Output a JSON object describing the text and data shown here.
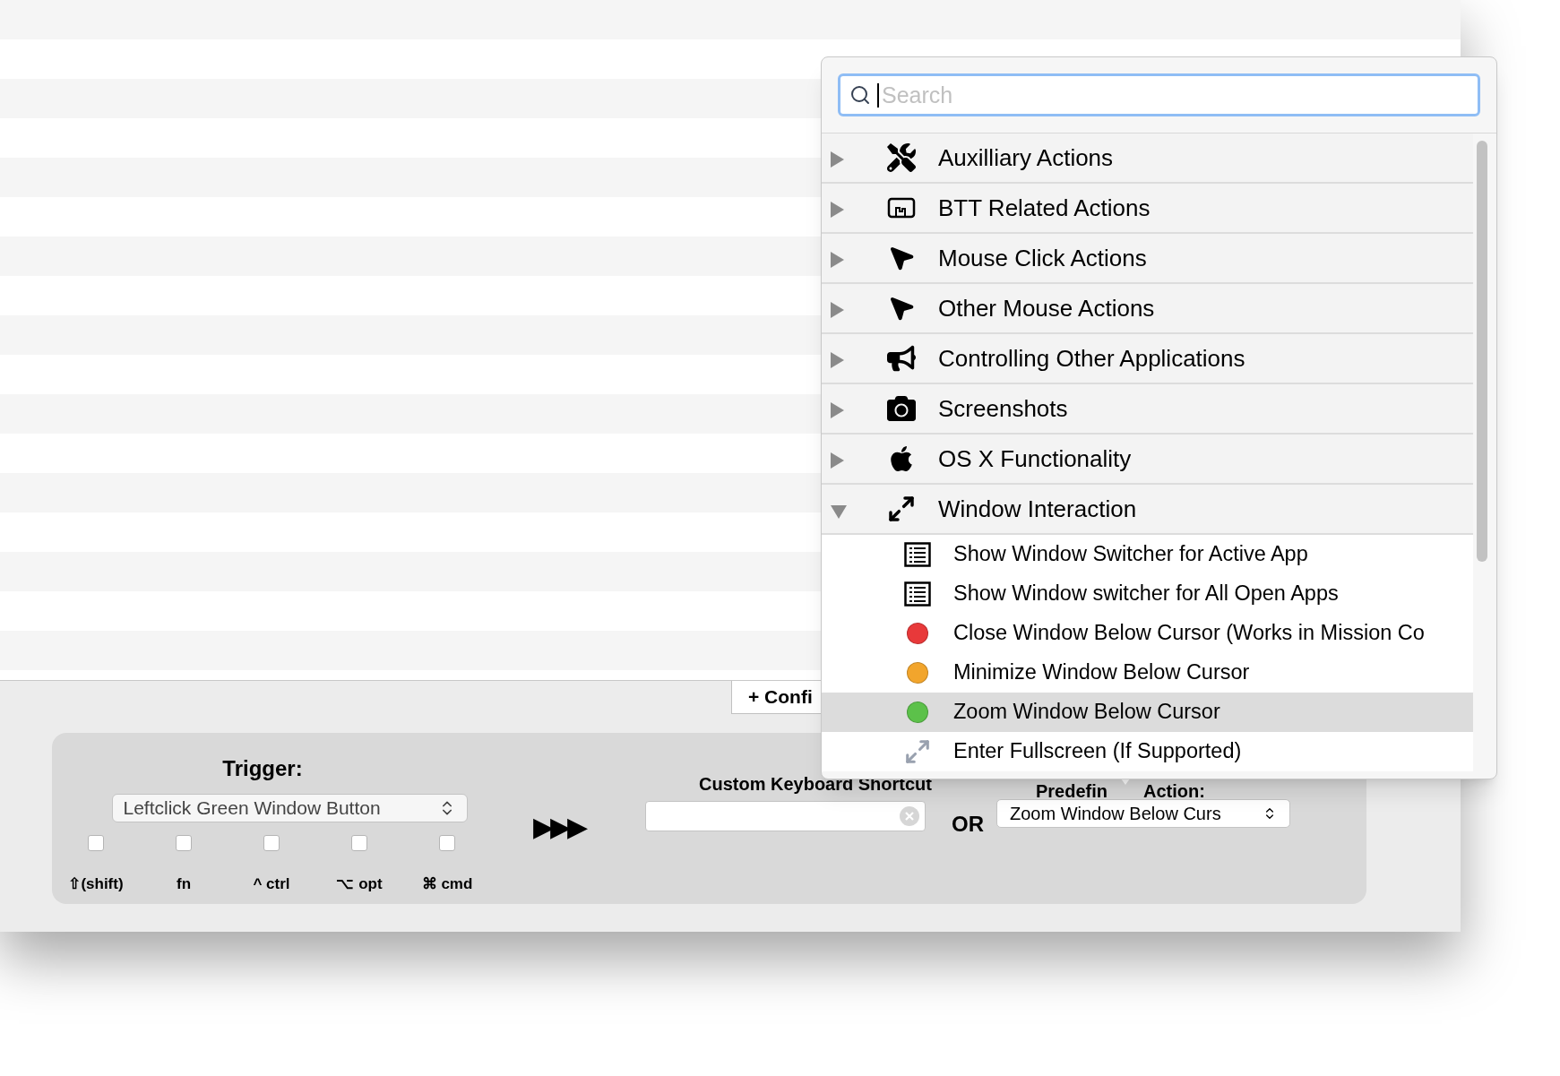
{
  "config_button": {
    "label": "+ Confi"
  },
  "trigger": {
    "label": "Trigger:",
    "value": "Leftclick Green Window Button",
    "modifiers": [
      {
        "label": "⇧(shift)",
        "checked": false
      },
      {
        "label": "fn",
        "checked": false
      },
      {
        "label": "^ ctrl",
        "checked": false
      },
      {
        "label": "⌥ opt",
        "checked": false
      },
      {
        "label": "⌘ cmd",
        "checked": false
      }
    ]
  },
  "arrows": "▶▶▶",
  "shortcut": {
    "label": "Custom Keyboard Shortcut"
  },
  "or_label": "OR",
  "predefined": {
    "label_parts": [
      "Predefin",
      "Action:"
    ],
    "value": "Zoom Window Below Curs"
  },
  "popup": {
    "search": {
      "placeholder": "Search"
    },
    "categories": [
      {
        "label": "Auxilliary Actions",
        "kind": "tools",
        "expanded": false
      },
      {
        "label": "BTT Related Actions",
        "kind": "screen",
        "expanded": false
      },
      {
        "label": "Mouse Click Actions",
        "kind": "click",
        "expanded": false
      },
      {
        "label": "Other Mouse Actions",
        "kind": "pointer",
        "expanded": false
      },
      {
        "label": "Controlling Other Applications",
        "kind": "megaphone",
        "expanded": false
      },
      {
        "label": "Screenshots",
        "kind": "camera",
        "expanded": false
      },
      {
        "label": "OS X Functionality",
        "kind": "apple",
        "expanded": false
      },
      {
        "label": "Window Interaction",
        "kind": "resize",
        "expanded": true,
        "children": [
          {
            "label": "Show Window Switcher for Active App",
            "kind": "list",
            "selected": false
          },
          {
            "label": "Show Window switcher for All Open Apps",
            "kind": "list",
            "selected": false
          },
          {
            "label": "Close Window Below Cursor (Works in Mission Co",
            "kind": "dot",
            "color": "#e8393a",
            "selected": false
          },
          {
            "label": "Minimize Window Below Cursor",
            "kind": "dot",
            "color": "#f2a52c",
            "selected": false
          },
          {
            "label": "Zoom Window Below Cursor",
            "kind": "dot",
            "color": "#5cc14a",
            "selected": true
          },
          {
            "label": "Enter Fullscreen (If Supported)",
            "kind": "fullscreen",
            "selected": false
          }
        ]
      }
    ]
  }
}
